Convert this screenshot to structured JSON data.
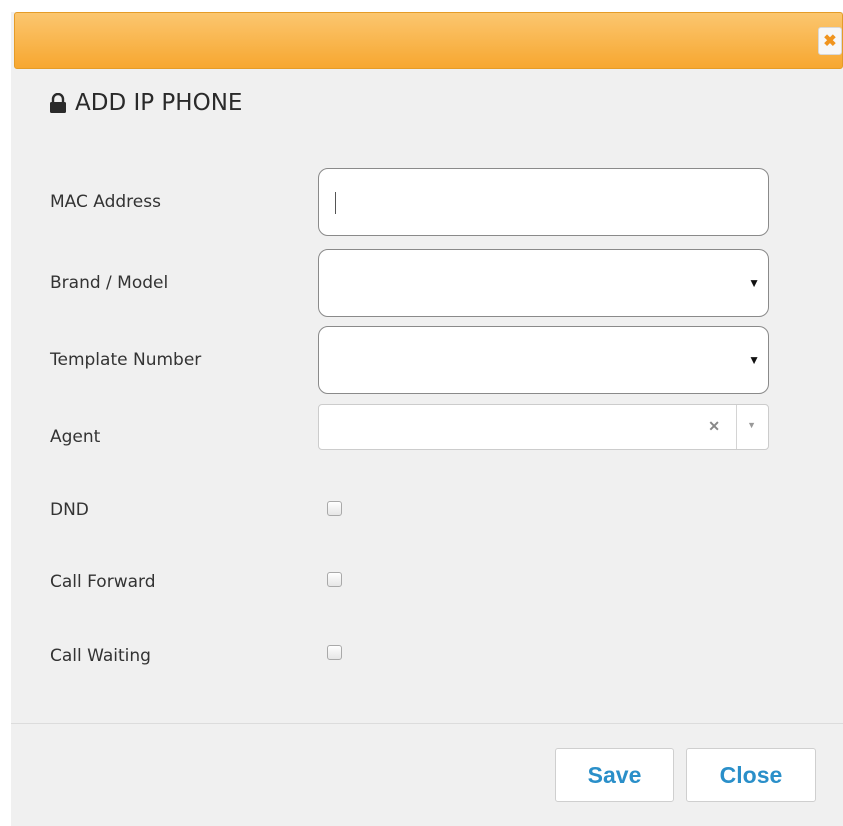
{
  "dialog": {
    "close_icon_glyph": "✖",
    "title": "ADD IP PHONE",
    "colors": {
      "titlebar": "#f7a730",
      "button_text": "#2a8fc9"
    }
  },
  "form": {
    "mac_label": "MAC Address",
    "mac_value": "",
    "brand_label": "Brand / Model",
    "brand_value": "",
    "template_label": "Template Number",
    "template_value": "",
    "agent_label": "Agent",
    "agent_value": "",
    "dnd_label": "DND",
    "dnd_checked": false,
    "call_forward_label": "Call Forward",
    "call_forward_checked": false,
    "call_waiting_label": "Call Waiting",
    "call_waiting_checked": false
  },
  "footer": {
    "save_label": "Save",
    "close_label": "Close"
  },
  "icons": {
    "heading": "lock-icon",
    "select_arrow": "caret-down-icon",
    "clear": "clear-icon"
  }
}
